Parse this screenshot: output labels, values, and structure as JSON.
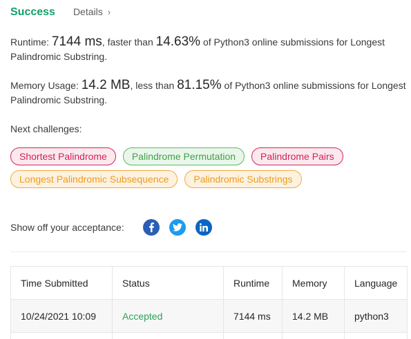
{
  "header": {
    "status": "Success",
    "details_label": "Details",
    "details_chevron": "›"
  },
  "runtime": {
    "label": "Runtime:",
    "value": "7144 ms",
    "comparison": ", faster than",
    "percent": "14.63%",
    "suffix": "of Python3 online submissions for Longest Palindromic Substring."
  },
  "memory": {
    "label": "Memory Usage:",
    "value": "14.2 MB",
    "comparison": ", less than",
    "percent": "81.15%",
    "suffix": "of Python3 online submissions for Longest Palindromic Substring."
  },
  "next_challenges": {
    "label": "Next challenges:",
    "items": [
      {
        "label": "Shortest Palindrome",
        "difficulty": "hard"
      },
      {
        "label": "Palindrome Permutation",
        "difficulty": "easy"
      },
      {
        "label": "Palindrome Pairs",
        "difficulty": "hard"
      },
      {
        "label": "Longest Palindromic Subsequence",
        "difficulty": "medium"
      },
      {
        "label": "Palindromic Substrings",
        "difficulty": "medium"
      }
    ]
  },
  "share": {
    "label": "Show off your acceptance:",
    "icons": [
      "facebook-icon",
      "twitter-icon",
      "linkedin-icon"
    ]
  },
  "submissions": {
    "columns": [
      "Time Submitted",
      "Status",
      "Runtime",
      "Memory",
      "Language"
    ],
    "rows": [
      [
        "10/24/2021 10:09",
        "Accepted",
        "7144 ms",
        "14.2 MB",
        "python3"
      ]
    ]
  },
  "colors": {
    "success": "#12a06b",
    "hard": "#d1225c",
    "easy": "#43a047",
    "medium": "#ef9b1c",
    "accepted": "#2aa35a"
  }
}
